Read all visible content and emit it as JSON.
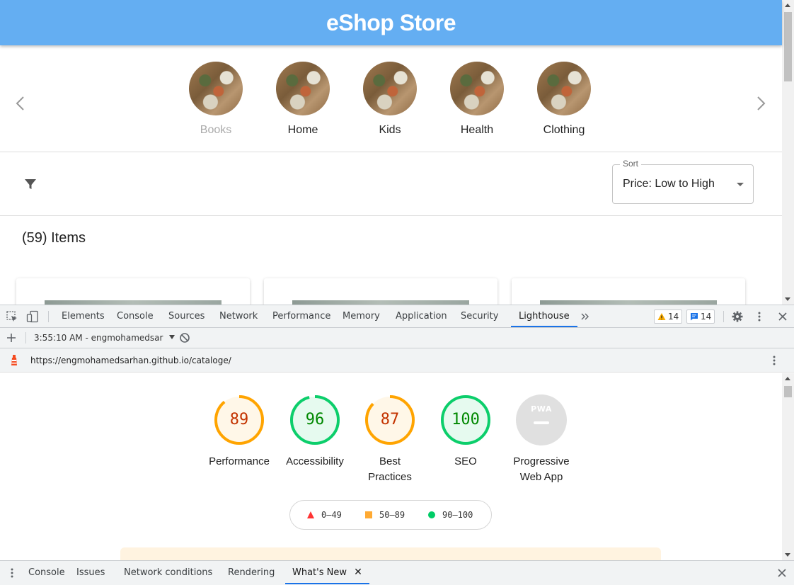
{
  "page": {
    "app_title": "eShop Store",
    "categories": [
      {
        "label": "Books",
        "state": "muted"
      },
      {
        "label": "Home"
      },
      {
        "label": "Kids"
      },
      {
        "label": "Health"
      },
      {
        "label": "Clothing"
      }
    ],
    "sort": {
      "label": "Sort",
      "value": "Price: Low to High"
    },
    "items_count": "(59) Items"
  },
  "devtools": {
    "tabs": [
      "Elements",
      "Console",
      "Sources",
      "Network",
      "Performance",
      "Memory",
      "Application",
      "Security",
      "Lighthouse"
    ],
    "active_tab": "Lighthouse",
    "more_tabs_icon": "chevron-double-right",
    "warnings_count": "14",
    "messages_count": "14",
    "lighthouse": {
      "report_select": "3:55:10 AM - engmohamedsar",
      "url": "https://engmohamedsarhan.github.io/cataloge/",
      "scores": [
        {
          "value": "89",
          "label": "Performance",
          "level": 0.89,
          "color": "#ffa400"
        },
        {
          "value": "96",
          "label": "Accessibility",
          "level": 0.96,
          "color": "#0cce6b"
        },
        {
          "value": "87",
          "label_line1": "Best",
          "label_line2": "Practices",
          "level": 0.87,
          "color": "#ffa400"
        },
        {
          "value": "100",
          "label": "SEO",
          "level": 1.0,
          "color": "#0cce6b"
        }
      ],
      "pwa": {
        "badge": "PWA",
        "label_line1": "Progressive",
        "label_line2": "Web App"
      },
      "legend": {
        "fail": "0–49",
        "average": "50–89",
        "pass": "90–100"
      }
    },
    "drawer_tabs": [
      "Console",
      "Issues",
      "Network conditions",
      "Rendering",
      "What's New"
    ],
    "active_drawer_tab": "What's New"
  },
  "colors": {
    "header_bg": "#64aef2",
    "score_average": "#ffa400",
    "score_pass": "#0cce6b",
    "score_fail": "#ff3333",
    "devtools_accent": "#1a73e8"
  }
}
